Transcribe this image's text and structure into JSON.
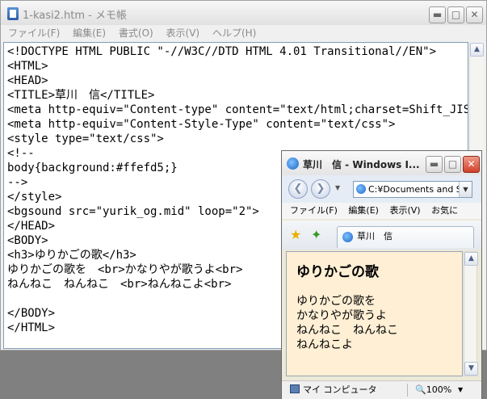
{
  "notepad": {
    "title": "1-kasi2.htm - メモ帳",
    "menu": [
      "ファイル(F)",
      "編集(E)",
      "書式(O)",
      "表示(V)",
      "ヘルプ(H)"
    ],
    "lines": [
      "<!DOCTYPE HTML PUBLIC \"-//W3C//DTD HTML 4.01 Transitional//EN\">",
      "<HTML>",
      "<HEAD>",
      "<TITLE>草川　信</TITLE>",
      "<meta http-equiv=\"Content-type\" content=\"text/html;charset=Shift_JIS\">",
      "<meta http-equiv=\"Content-Style-Type\" content=\"text/css\">",
      "<style type=\"text/css\">",
      "<!--",
      "body{background:#ffefd5;}",
      "-->",
      "</style>",
      "<bgsound src=\"yurik_og.mid\" loop=\"2\">",
      "</HEAD>",
      "<BODY>",
      "<h3>ゆりかごの歌</h3>",
      "ゆりかごの歌を　<br>かなりやが歌うよ<br>",
      "ねんねこ　ねんねこ　<br>ねんねこよ<br>",
      "",
      "</BODY>",
      "</HTML>"
    ]
  },
  "ie": {
    "title": "草川　信 - Windows I...",
    "address": "C:¥Documents and S",
    "menu": [
      "ファイル(F)",
      "編集(E)",
      "表示(V)",
      "お気に"
    ],
    "tab_label": "草川　信",
    "page_heading": "ゆりかごの歌",
    "page_lines": [
      "ゆりかごの歌を",
      "かなりやが歌うよ",
      "ねんねこ　ねんねこ",
      "ねんねこよ"
    ],
    "page_background": "#ffefd5",
    "status": "マイ コンピュータ",
    "zoom": "🔍100%"
  }
}
